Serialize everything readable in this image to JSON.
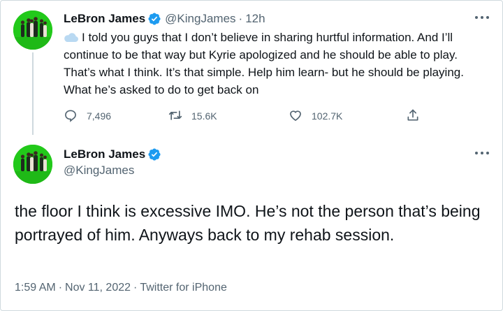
{
  "tweet1": {
    "author_name": "LeBron James",
    "handle": "@KingJames",
    "separator": "·",
    "time": "12h",
    "text": "I told you guys that I don’t believe in sharing hurtful information. And I’ll continue to be that way but Kyrie apologized and he should be able to play. That’s what I think. It’s that simple.  Help him learn- but he should be playing. What he’s asked to do to get back on",
    "reply_count": "7,496",
    "retweet_count": "15.6K",
    "like_count": "102.7K"
  },
  "tweet2": {
    "author_name": "LeBron James",
    "handle": "@KingJames",
    "text": "the floor I think is excessive IMO. He’s not the person that’s being portrayed of him. Anyways back to my rehab session.",
    "time": "1:59 AM",
    "separator": "·",
    "date": "Nov 11, 2022",
    "separator2": "·",
    "source": "Twitter for iPhone"
  },
  "colors": {
    "verified": "#1d9bf0",
    "secondary_text": "#536471",
    "avatar_bg": "#22c91a",
    "thread_line": "#cfd9de"
  },
  "icons": [
    "verified-badge-icon",
    "more-icon",
    "cloud-emoji-icon",
    "reply-icon",
    "retweet-icon",
    "like-icon",
    "share-icon"
  ]
}
